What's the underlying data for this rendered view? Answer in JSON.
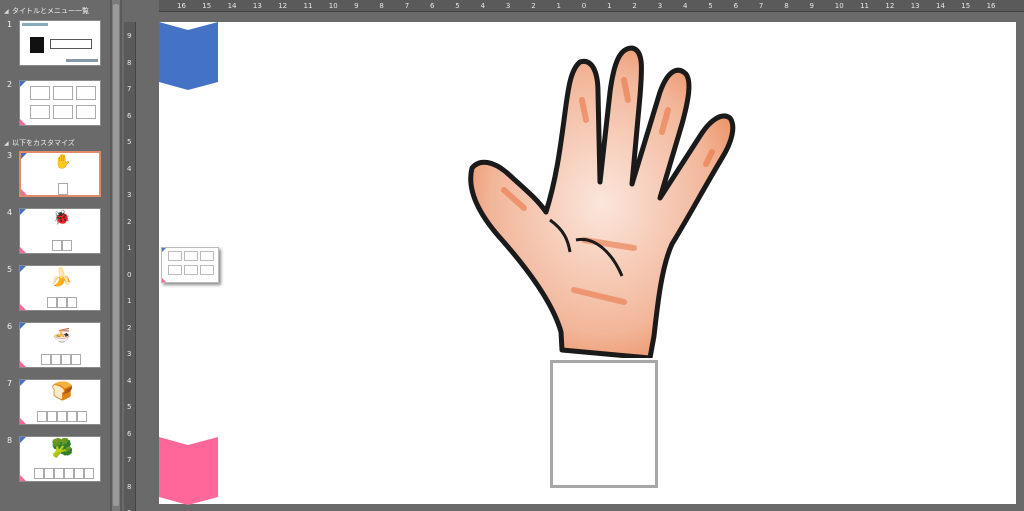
{
  "sections": [
    {
      "label": "タイトルとメニュー一覧"
    },
    {
      "label": "以下をカスタマイズ"
    }
  ],
  "slides": [
    {
      "number": "1",
      "art": ""
    },
    {
      "number": "2",
      "art": ""
    },
    {
      "number": "3",
      "art": "✋"
    },
    {
      "number": "4",
      "art": "🐞"
    },
    {
      "number": "5",
      "art": "🍌"
    },
    {
      "number": "6",
      "art": "🍜"
    },
    {
      "number": "7",
      "art": "🍞"
    },
    {
      "number": "8",
      "art": "🥦"
    }
  ],
  "selected_slide": "3",
  "hruler_labels": [
    "16",
    "15",
    "14",
    "13",
    "12",
    "11",
    "10",
    "9",
    "8",
    "7",
    "6",
    "5",
    "4",
    "3",
    "2",
    "1",
    "0",
    "1",
    "2",
    "3",
    "4",
    "5",
    "6",
    "7",
    "8",
    "9",
    "10",
    "11",
    "12",
    "13",
    "14",
    "15",
    "16"
  ],
  "vruler_labels": [
    "9",
    "8",
    "7",
    "6",
    "5",
    "4",
    "3",
    "2",
    "1",
    "0",
    "1",
    "2",
    "3",
    "4",
    "5",
    "6",
    "7",
    "8",
    "9"
  ],
  "colors": {
    "accent_blue": "#4472c4",
    "accent_pink": "#ff6699",
    "selected_border": "#e08a6a",
    "skin": "#f0c4a8",
    "skin_shade": "#e8703f"
  },
  "icons": {
    "blue_marker": "chevron-down-icon",
    "pink_marker": "chevron-down-icon",
    "main_image": "hand-illustration"
  }
}
